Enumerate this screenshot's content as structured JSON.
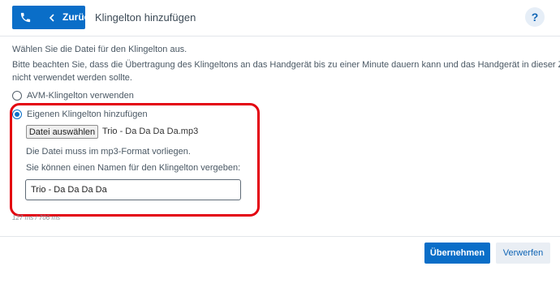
{
  "header": {
    "back_label": "Zurück",
    "title": "Klingelton hinzufügen",
    "help_label": "?"
  },
  "intro": {
    "line1": "Wählen Sie die Datei für den Klingelton aus.",
    "line2": "Bitte beachten Sie, dass die Übertragung des Klingeltons an das Handgerät bis zu einer Minute dauern kann und das Handgerät in dieser Zeit",
    "line3": "nicht verwendet werden sollte."
  },
  "options": {
    "avm_label": "AVM-Klingelton verwenden",
    "custom_label": "Eigenen Klingelton hinzufügen"
  },
  "file": {
    "button_label": "Datei auswählen",
    "selected_name": "Trio - Da Da Da Da.mp3",
    "format_hint": "Die Datei muss im mp3-Format vorliegen."
  },
  "name_field": {
    "label": "Sie können einen Namen für den Klingelton vergeben:",
    "value": "Trio - Da Da Da Da"
  },
  "timing": "127 ms / 706 ms",
  "footer": {
    "apply_label": "Übernehmen",
    "discard_label": "Verwerfen"
  },
  "colors": {
    "primary": "#0a6ec8",
    "highlight": "#e3000f"
  }
}
